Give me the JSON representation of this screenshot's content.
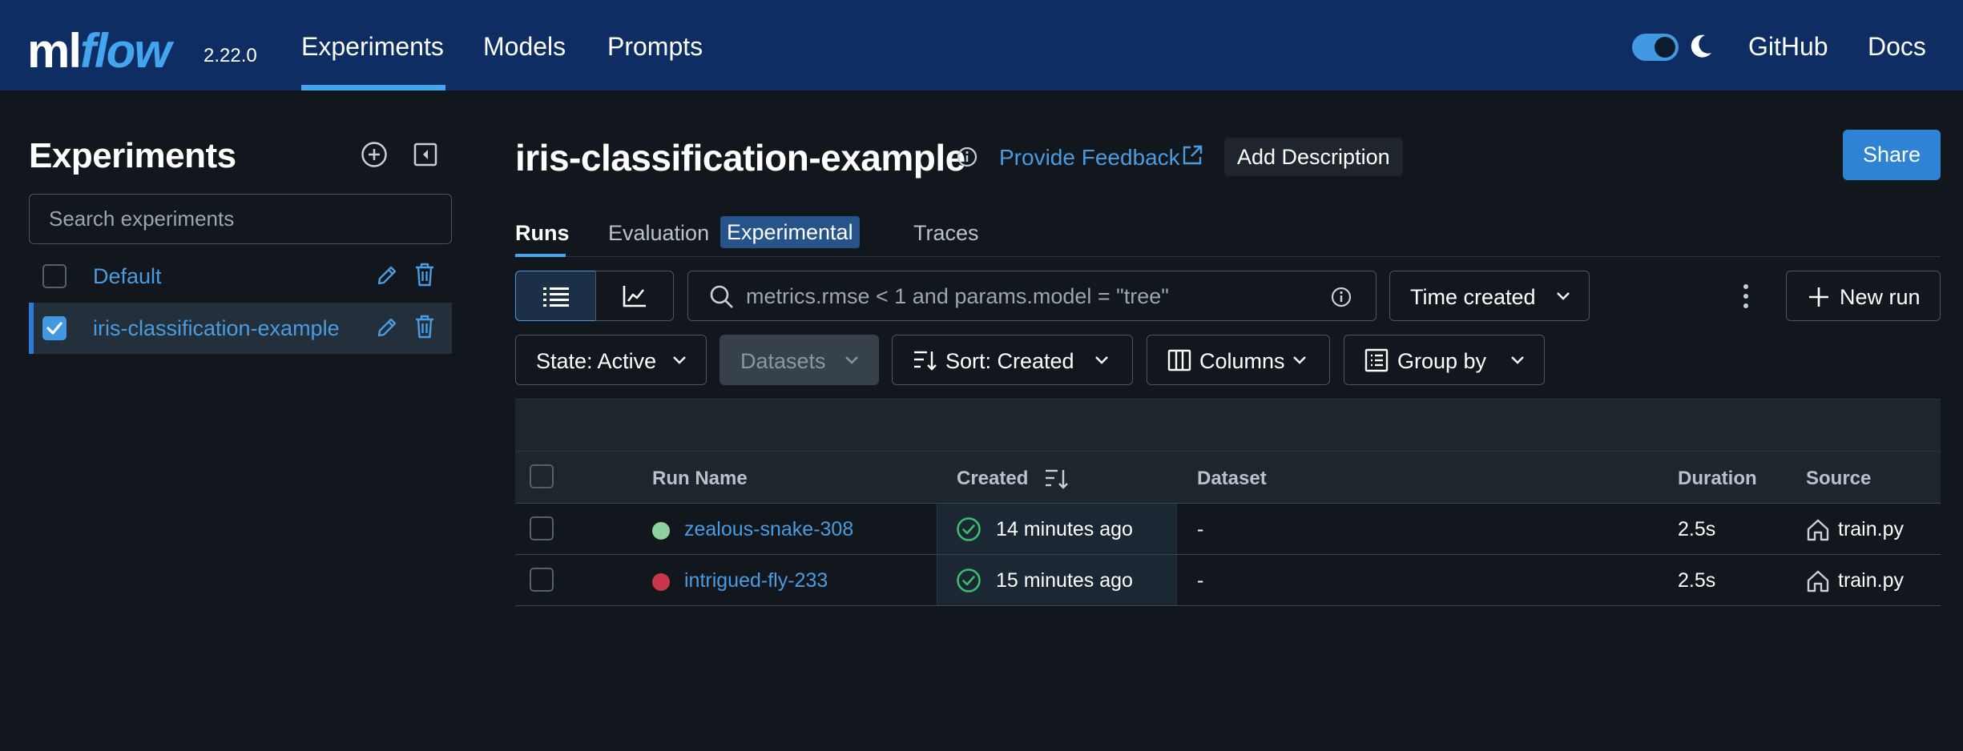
{
  "header": {
    "logo_ml": "ml",
    "logo_flow": "flow",
    "version": "2.22.0",
    "nav": [
      "Experiments",
      "Models",
      "Prompts"
    ],
    "active_nav": "Experiments",
    "links": {
      "github": "GitHub",
      "docs": "Docs"
    },
    "dark_mode": true
  },
  "sidebar": {
    "title": "Experiments",
    "search_placeholder": "Search experiments",
    "experiments": [
      {
        "name": "Default",
        "selected": false
      },
      {
        "name": "iris-classification-example",
        "selected": true
      }
    ]
  },
  "main": {
    "title": "iris-classification-example",
    "feedback_label": "Provide Feedback",
    "add_description_label": "Add Description",
    "share_label": "Share",
    "tabs": [
      {
        "label": "Runs",
        "active": true
      },
      {
        "label": "Evaluation",
        "badge": "Experimental"
      },
      {
        "label": "Traces"
      }
    ],
    "filter_placeholder": "metrics.rmse < 1 and params.model = \"tree\"",
    "time_created_label": "Time created",
    "new_run_label": "New run",
    "state_label": "State: Active",
    "datasets_label": "Datasets",
    "sort_label": "Sort: Created",
    "columns_label": "Columns",
    "group_by_label": "Group by"
  },
  "table": {
    "columns": [
      "Run Name",
      "Created",
      "Dataset",
      "Duration",
      "Source"
    ],
    "rows": [
      {
        "run_name": "zealous-snake-308",
        "status_color": "#8fd19e",
        "created": "14 minutes ago",
        "dataset": "-",
        "duration": "2.5s",
        "source": "train.py"
      },
      {
        "run_name": "intrigued-fly-233",
        "status_color": "#c8384a",
        "created": "15 minutes ago",
        "dataset": "-",
        "duration": "2.5s",
        "source": "train.py"
      }
    ]
  },
  "colors": {
    "topbar": "#0e2d63",
    "accent": "#43a5f0",
    "link": "#4a9be0",
    "background": "#11171c",
    "share_button": "#2f83d4"
  }
}
